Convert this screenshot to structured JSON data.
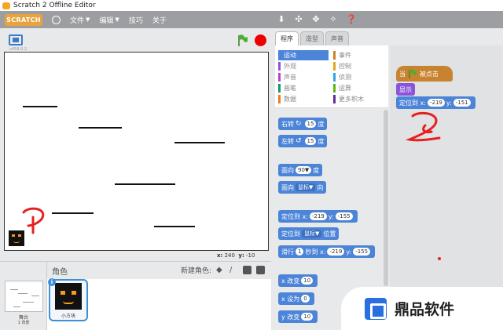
{
  "window": {
    "title": "Scratch 2 Offline Editor"
  },
  "menubar": {
    "logo": "SCRATCH",
    "items": [
      {
        "label": "文件",
        "caret": "▼"
      },
      {
        "label": "编辑",
        "caret": "▼"
      },
      {
        "label": "技巧"
      },
      {
        "label": "关于"
      }
    ],
    "tools": [
      "stamp-icon",
      "cut-icon",
      "grow-icon",
      "shrink-icon",
      "help-icon"
    ]
  },
  "stage": {
    "version": "v458.0.2",
    "coords": {
      "x_label": "x:",
      "x_value": "240",
      "y_label": "y:",
      "y_value": "-10"
    }
  },
  "sprites_pane": {
    "header": "角色",
    "new_sprite_label": "新建角色:",
    "stage_label": "舞台",
    "backdrop_count": "1 背景",
    "sprite_name": "小方块"
  },
  "tabs": [
    {
      "label": "程序",
      "active": true
    },
    {
      "label": "造型",
      "active": false
    },
    {
      "label": "声音",
      "active": false
    }
  ],
  "categories": [
    {
      "label": "运动",
      "color": "#4c84d8",
      "selected": true
    },
    {
      "label": "事件",
      "color": "#c88330",
      "selected": false
    },
    {
      "label": "外观",
      "color": "#8a55d7",
      "selected": false
    },
    {
      "label": "控制",
      "color": "#e1a91a",
      "selected": false
    },
    {
      "label": "声音",
      "color": "#bb42c3",
      "selected": false
    },
    {
      "label": "侦测",
      "color": "#2ca5e2",
      "selected": false
    },
    {
      "label": "画笔",
      "color": "#0e9a6c",
      "selected": false
    },
    {
      "label": "运算",
      "color": "#5cb712",
      "selected": false
    },
    {
      "label": "数据",
      "color": "#ee7d16",
      "selected": false
    },
    {
      "label": "更多积木",
      "color": "#632d99",
      "selected": false
    }
  ],
  "blocks": {
    "turn_right": {
      "pre": "右转",
      "value": "15",
      "post": "度"
    },
    "turn_left": {
      "pre": "左转",
      "value": "15",
      "post": "度"
    },
    "point_dir": {
      "pre": "面向",
      "value": "90▼",
      "post": "度"
    },
    "point_toward": {
      "pre": "面向",
      "value": "鼠标▼",
      "post": "向"
    },
    "goto_xy": {
      "pre": "定位到 x:",
      "x": "-219",
      "y_label": "y:",
      "y": "-155"
    },
    "goto_target": {
      "pre": "定位到",
      "value": "鼠标▼",
      "post": "位置"
    },
    "glide": {
      "pre": "滑行",
      "secs": "1",
      "mid": "秒到 x:",
      "x": "-219",
      "y_label": "y:",
      "y": "-155"
    },
    "change_x": {
      "pre": "x 改变",
      "value": "10"
    },
    "set_x": {
      "pre": "x 设为",
      "value": "0"
    },
    "change_y": {
      "pre": "y 改变",
      "value": "10"
    }
  },
  "script": {
    "hat": {
      "pre": "当",
      "post": "被点击"
    },
    "show": {
      "label": "显示"
    },
    "goto": {
      "pre": "定位到 x:",
      "x": "-219",
      "y_label": "y:",
      "y": "-151"
    }
  },
  "annotations": {
    "num1": "1",
    "num2": "2"
  },
  "watermark": {
    "text": "鼎品软件"
  }
}
